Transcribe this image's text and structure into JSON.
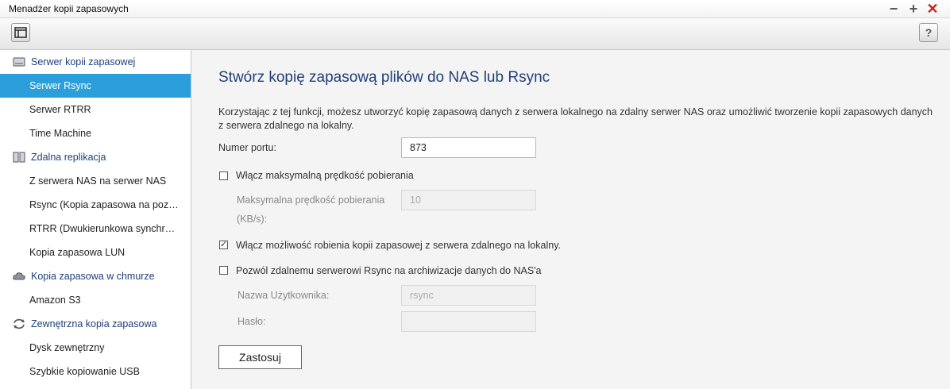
{
  "window": {
    "title": "Menadżer kopii zapasowych"
  },
  "toolbar": {
    "help_label": "?"
  },
  "sidebar": {
    "sections": [
      {
        "label": "Serwer kopii zapasowej",
        "icon": "drive-icon",
        "items": [
          "Serwer Rsync",
          "Serwer RTRR",
          "Time Machine"
        ]
      },
      {
        "label": "Zdalna replikacja",
        "icon": "servers-icon",
        "items": [
          "Z serwera NAS na serwer NAS",
          "Rsync (Kopia zapasowa na poziomie plików)",
          "RTRR (Dwukierunkowa synchronizacja)",
          "Kopia zapasowa LUN"
        ]
      },
      {
        "label": "Kopia zapasowa w chmurze",
        "icon": "cloud-icon",
        "items": [
          "Amazon S3"
        ]
      },
      {
        "label": "Zewnętrzna kopia zapasowa",
        "icon": "sync-icon",
        "items": [
          "Dysk zewnętrzny",
          "Szybkie kopiowanie USB"
        ]
      }
    ],
    "active_item": "Serwer Rsync"
  },
  "main": {
    "heading": "Stwórz kopię zapasową plików do NAS lub Rsync",
    "description": "Korzystając z tej funkcji, możesz utworzyć kopię zapasową danych z serwera lokalnego na zdalny serwer NAS oraz umożliwić tworzenie kopii zapasowych danych z serwera zdalnego na lokalny.",
    "port_label": "Numer portu:",
    "port_value": "873",
    "max_speed_checkbox": {
      "label": "Włącz maksymalną prędkość pobierania",
      "checked": false
    },
    "max_speed_label_1": "Maksymalna prędkość pobierania",
    "max_speed_label_2": "(KB/s):",
    "max_speed_value": "10",
    "remote_backup_checkbox": {
      "label": "Włącz możliwość robienia kopii zapasowej z serwera zdalnego na lokalny.",
      "checked": true
    },
    "allow_rsync_checkbox": {
      "label": "Pozwól zdalnemu serwerowi Rsync na archiwizacje danych do NAS'a",
      "checked": false
    },
    "username_label": "Nazwa Użytkownika:",
    "username_placeholder": "rsync",
    "password_label": "Hasło:",
    "password_value": "",
    "apply_label": "Zastosuj"
  }
}
